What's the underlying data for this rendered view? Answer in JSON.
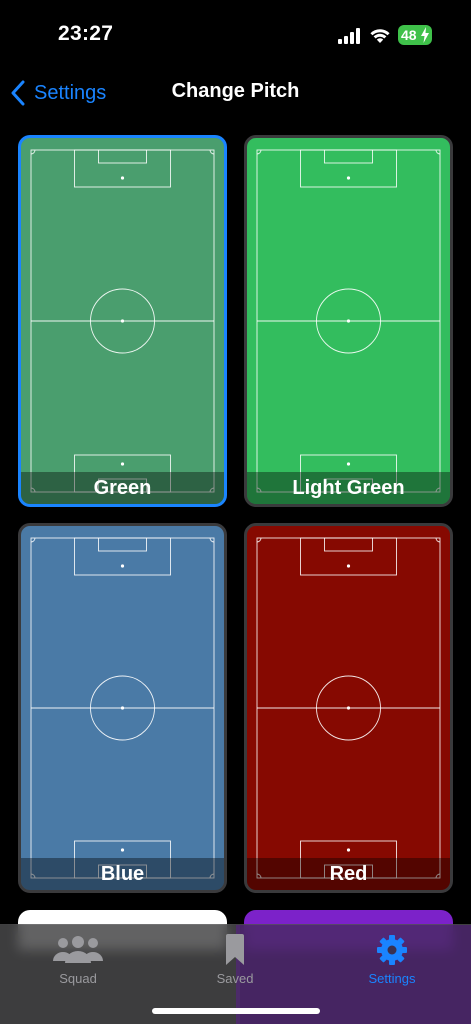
{
  "status_bar": {
    "time": "23:27",
    "battery": "48"
  },
  "nav": {
    "back_label": "Settings",
    "title": "Change Pitch"
  },
  "pitches": [
    {
      "label": "Green",
      "color": "#4a9e6e",
      "selected": true
    },
    {
      "label": "Light Green",
      "color": "#33bd5e",
      "selected": false
    },
    {
      "label": "Blue",
      "color": "#4a7aa6",
      "selected": false
    },
    {
      "label": "Red",
      "color": "#860901",
      "selected": false
    }
  ],
  "peek_colors": [
    "#ffffff",
    "#7c22c9"
  ],
  "tabs": [
    {
      "label": "Squad",
      "icon": "squad-icon",
      "active": false
    },
    {
      "label": "Saved",
      "icon": "bookmark-icon",
      "active": false
    },
    {
      "label": "Settings",
      "icon": "gear-icon",
      "active": true
    }
  ],
  "colors": {
    "accent": "#1a84ff",
    "inactive": "#9a9a9e"
  }
}
